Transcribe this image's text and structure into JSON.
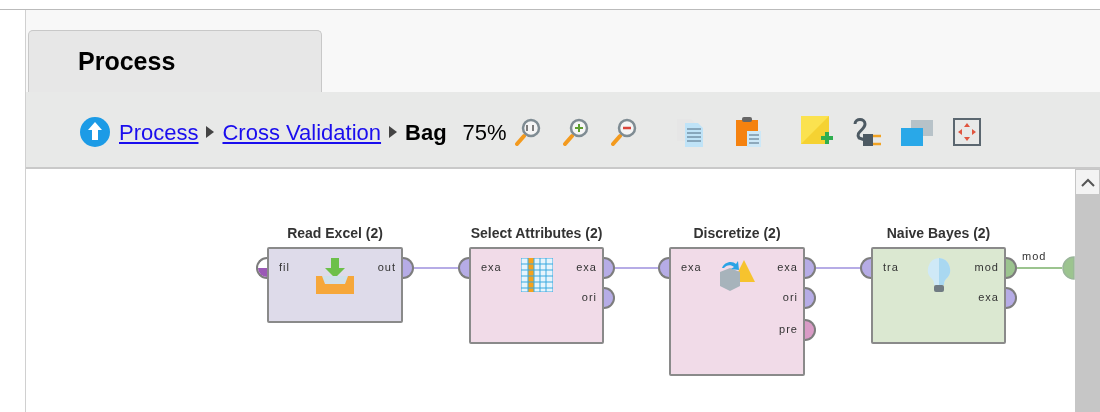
{
  "tab": {
    "label": "Process",
    "selected": true
  },
  "breadcrumb": [
    {
      "label": "Process",
      "kind": "link"
    },
    {
      "label": "Cross Validation",
      "kind": "link"
    },
    {
      "label": "Bag",
      "kind": "current"
    }
  ],
  "zoom": "75%",
  "operators": [
    {
      "title": "Read Excel (2)",
      "color": "#dedbea",
      "inputs": [
        {
          "label": "fil",
          "kind": "partial",
          "color": "#9b59b6"
        }
      ],
      "outputs": [
        {
          "label": "out",
          "kind": "full",
          "color": "#b6ace6"
        }
      ]
    },
    {
      "title": "Select Attributes (2)",
      "color": "#f1dbe8",
      "inputs": [
        {
          "label": "exa",
          "kind": "full",
          "color": "#b6ace6"
        }
      ],
      "outputs": [
        {
          "label": "exa",
          "kind": "full",
          "color": "#b6ace6"
        },
        {
          "label": "ori",
          "kind": "full",
          "color": "#b6ace6"
        }
      ]
    },
    {
      "title": "Discretize (2)",
      "color": "#f1dbe8",
      "inputs": [
        {
          "label": "exa",
          "kind": "full",
          "color": "#b6ace6"
        }
      ],
      "outputs": [
        {
          "label": "exa",
          "kind": "full",
          "color": "#b6ace6"
        },
        {
          "label": "ori",
          "kind": "full",
          "color": "#b6ace6"
        },
        {
          "label": "pre",
          "kind": "full",
          "color": "#d99bc6"
        }
      ]
    },
    {
      "title": "Naive Bayes (2)",
      "color": "#dbe8d1",
      "inputs": [
        {
          "label": "tra",
          "kind": "full",
          "color": "#b6ace6"
        }
      ],
      "outputs": [
        {
          "label": "mod",
          "kind": "full",
          "color": "#9cc48f"
        },
        {
          "label": "exa",
          "kind": "full",
          "color": "#b6ace6"
        }
      ]
    }
  ],
  "exit_wire": {
    "label": "mod",
    "color": "#9cc48f"
  }
}
